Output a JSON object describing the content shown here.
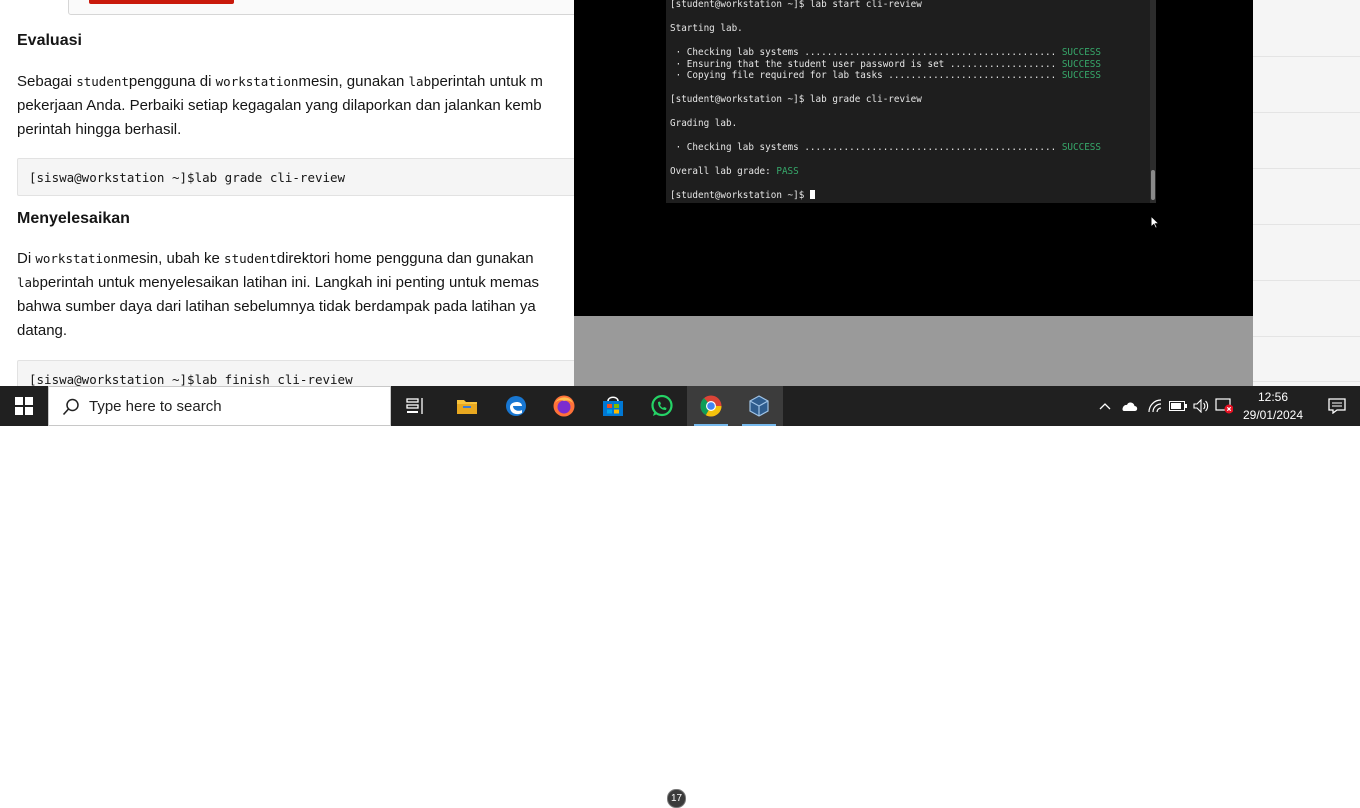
{
  "document": {
    "heading_evaluasi": "Evaluasi",
    "para1": {
      "l1_a": "Sebagai ",
      "l1_code1": "student",
      "l1_b": "pengguna di ",
      "l1_code2": "workstation",
      "l1_c": "mesin, gunakan ",
      "l1_code3": "lab",
      "l1_d": "perintah untuk m",
      "l2": "pekerjaan Anda. Perbaiki setiap kegagalan yang dilaporkan dan jalankan kemb",
      "l3": "perintah hingga berhasil."
    },
    "code1": "[siswa@workstation ~]$lab grade cli-review",
    "heading_menyelesaikan": "Menyelesaikan",
    "para2": {
      "l1_a": "Di ",
      "l1_code1": "workstation",
      "l1_b": "mesin, ubah ke ",
      "l1_code2": "student",
      "l1_c": "direktori home pengguna dan gunakan",
      "l2_code": "lab",
      "l2_b": "perintah untuk menyelesaikan latihan ini. Langkah ini penting untuk memas",
      "l3": "bahwa sumber daya dari latihan sebelumnya tidak berdampak pada latihan ya",
      "l4": "datang."
    },
    "code2": "[siswa@workstation ~]$lab finish cli-review"
  },
  "terminal": {
    "line1": "[student@workstation ~]$ lab start cli-review",
    "line2": "Starting lab.",
    "check1": " · Checking lab systems ............................................. ",
    "check2": " · Ensuring that the student user password is set ................... ",
    "check3": " · Copying file required for lab tasks .............................. ",
    "success": "SUCCESS",
    "line3": "[student@workstation ~]$ lab grade cli-review",
    "line4": "Grading lab.",
    "check4": " · Checking lab systems ............................................. ",
    "overall": "Overall lab grade: ",
    "pass": "PASS",
    "prompt": "[student@workstation ~]$ "
  },
  "taskbar": {
    "search_placeholder": "Type here to search",
    "whatsapp_badge": "17",
    "time": "12:56",
    "date": "29/01/2024",
    "icons": [
      "windows-start-icon",
      "search-icon",
      "task-view-icon",
      "file-explorer-icon",
      "edge-icon",
      "firefox-icon",
      "microsoft-store-icon",
      "whatsapp-icon",
      "chrome-icon",
      "virtualbox-icon",
      "chevron-up-icon",
      "onedrive-icon",
      "wifi-icon",
      "battery-icon",
      "volume-icon",
      "security-icon",
      "notification-icon"
    ]
  }
}
